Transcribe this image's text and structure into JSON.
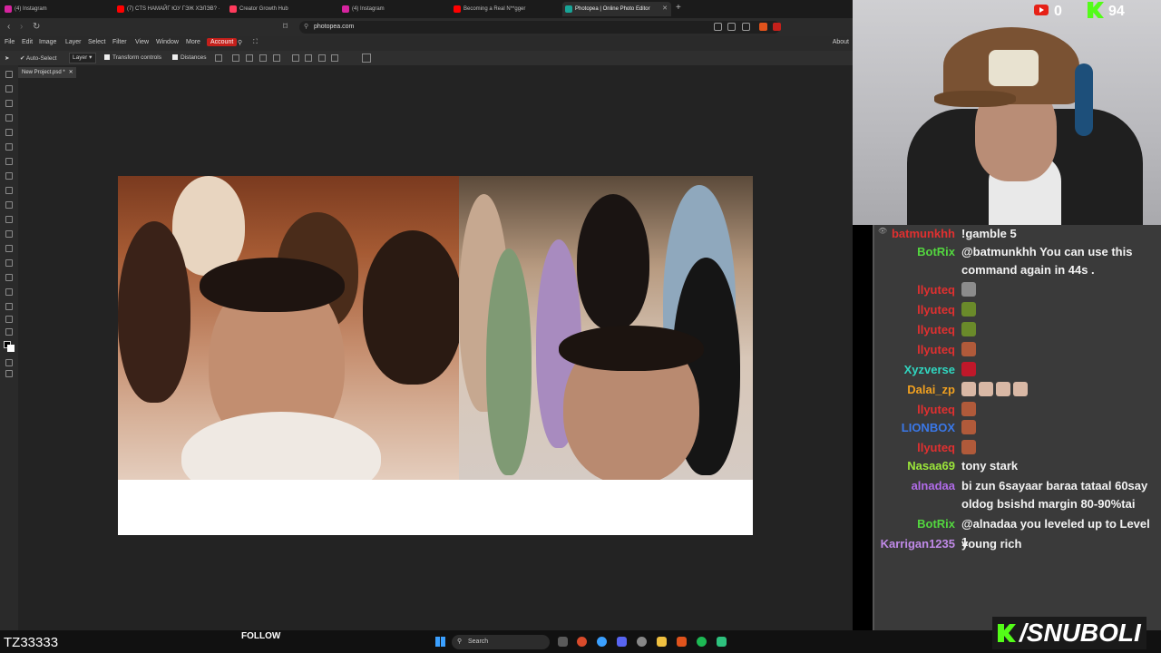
{
  "browser": {
    "tabs": [
      {
        "label": "(4) Instagram",
        "color": "#d6249f"
      },
      {
        "label": "(7) CTS НАМАЙГ ЮУ ГЭЖ ХЭЛЭВ? ·",
        "color": "#ff0000"
      },
      {
        "label": "Creator Growth Hub",
        "color": "#ff3b5c"
      },
      {
        "label": "(4) Instagram",
        "color": "#d6249f"
      },
      {
        "label": "Becoming a Real N**gger",
        "color": "#ff0000"
      },
      {
        "label": "Photopea | Online Photo Editor",
        "color": "#18a497"
      }
    ],
    "url": "photopea.com"
  },
  "photopea": {
    "menu": [
      "File",
      "Edit",
      "Image",
      "Layer",
      "Select",
      "Filter",
      "View",
      "Window",
      "More",
      "Account"
    ],
    "about": "About",
    "options": {
      "auto_select": "Auto-Select",
      "layer_dropdown": "Layer",
      "transform_controls": "Transform controls",
      "distances": "Distances"
    },
    "document_tab": "New Project.psd *"
  },
  "stream": {
    "youtube_count": "0",
    "kick_count": "94",
    "channel_name": "TZ33333",
    "follow_label": "FOLLOW",
    "brand": "/SNUBOLI",
    "taskbar_search": "Search"
  },
  "chat": {
    "messages": [
      {
        "user": "batmunkhh",
        "color": "#e03030",
        "text": "!gamble 5"
      },
      {
        "user": "BotRix",
        "color": "#53d63f",
        "text": "@batmunkhh You can use this command again in 44s ."
      },
      {
        "user": "llyuteq",
        "color": "#e03030",
        "text": "",
        "emotes": [
          "#8c8c8c"
        ]
      },
      {
        "user": "llyuteq",
        "color": "#e03030",
        "text": "",
        "emotes": [
          "#6a8a2a"
        ]
      },
      {
        "user": "llyuteq",
        "color": "#e03030",
        "text": "",
        "emotes": [
          "#6a8a2a"
        ]
      },
      {
        "user": "llyuteq",
        "color": "#e03030",
        "text": "",
        "emotes": [
          "#b05a3a"
        ]
      },
      {
        "user": "Xyzverse",
        "color": "#30d6c0",
        "text": "",
        "emotes": [
          "#c0182a"
        ]
      },
      {
        "user": "Dalai_zp",
        "color": "#f0a020",
        "text": "",
        "emotes": [
          "#d9b8a5",
          "#d9b8a5",
          "#d9b8a5",
          "#d9b8a5"
        ]
      },
      {
        "user": "llyuteq",
        "color": "#e03030",
        "text": "",
        "emotes": [
          "#b05a3a"
        ]
      },
      {
        "user": "LIONBOX",
        "color": "#3a78e8",
        "text": "",
        "emotes": [
          "#b05a3a"
        ]
      },
      {
        "user": "llyuteq",
        "color": "#e03030",
        "text": "",
        "emotes": [
          "#b05a3a"
        ]
      },
      {
        "user": "Nasaa69",
        "color": "#9be63a",
        "text": "tony stark"
      },
      {
        "user": "alnadaa",
        "color": "#b06be8",
        "text": "bi zun 6sayaar baraa tataal 60say oldog bsishd margin 80-90%tai"
      },
      {
        "user": "BotRix",
        "color": "#53d63f",
        "text": "@alnadaa you leveled up to Level 1"
      },
      {
        "user": "Karrigan1235",
        "color": "#c08ae8",
        "text": "young rich"
      }
    ]
  }
}
